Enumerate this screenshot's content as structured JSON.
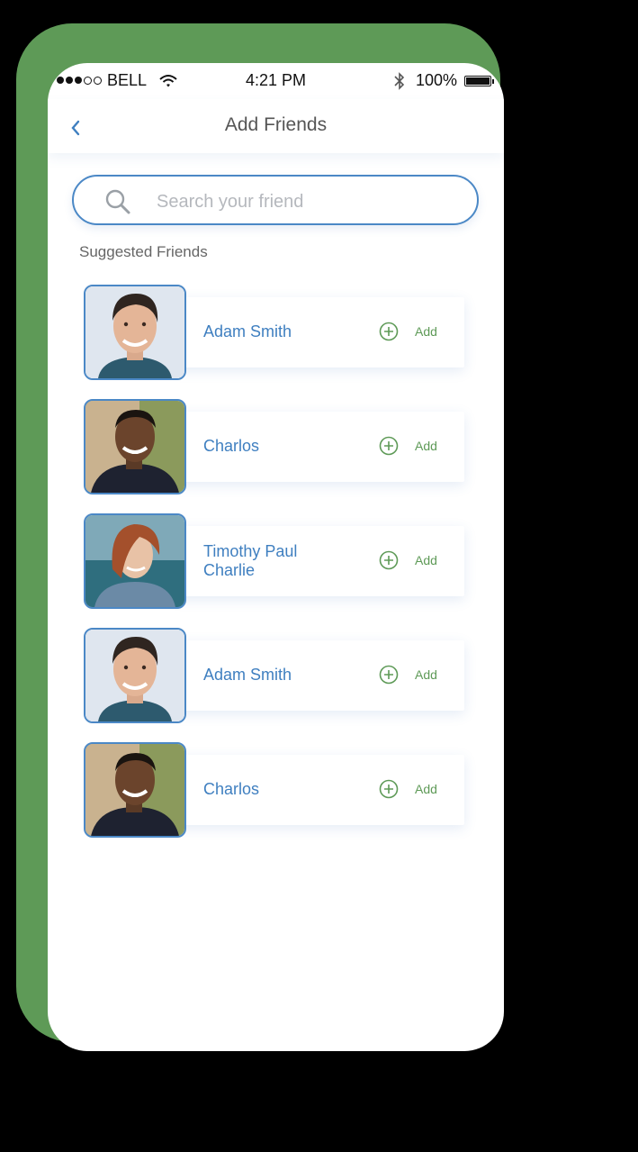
{
  "status_bar": {
    "carrier": "BELL",
    "time": "4:21 PM",
    "battery": "100%",
    "signal_bars_filled": 3,
    "signal_bars_total": 5
  },
  "header": {
    "title": "Add Friends",
    "back_icon": "chevron-left-icon"
  },
  "search": {
    "placeholder": "Search your friend",
    "value": "",
    "icon": "search-icon"
  },
  "section_label": "Suggested Friends",
  "friends": [
    {
      "name_line1": "Adam Smith",
      "name_line2": "",
      "add_label": "Add",
      "avatar": "man-brown-hair"
    },
    {
      "name_line1": "Charlos",
      "name_line2": "",
      "add_label": "Add",
      "avatar": "man-dark-skin"
    },
    {
      "name_line1": "Timothy Paul",
      "name_line2": "Charlie",
      "add_label": "Add",
      "avatar": "woman-red-hair"
    },
    {
      "name_line1": "Adam Smith",
      "name_line2": "",
      "add_label": "Add",
      "avatar": "man-brown-hair"
    },
    {
      "name_line1": "Charlos",
      "name_line2": "",
      "add_label": "Add",
      "avatar": "man-dark-skin"
    }
  ],
  "colors": {
    "frame": "#5e9a57",
    "accent_blue": "#4b88c6",
    "name_blue": "#3f7fc0",
    "add_green": "#5e9a57"
  }
}
